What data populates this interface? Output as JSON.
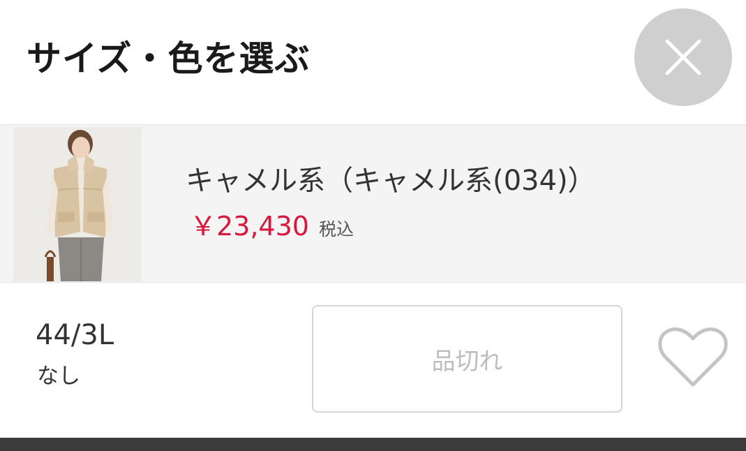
{
  "header": {
    "title": "サイズ・色を選ぶ"
  },
  "product": {
    "color_name": "キャメル系（キャメル系(034)）",
    "price": "￥23,430",
    "tax_label": "税込"
  },
  "variant": {
    "size": "44/3L",
    "stock": "なし",
    "action_label": "品切れ"
  },
  "colors": {
    "price": "#d9173c",
    "close_bg": "#cfcfcf",
    "bottom_bar": "#3b3b3b"
  },
  "icons": {
    "close": "close-icon",
    "favorite": "heart-outline-icon"
  }
}
